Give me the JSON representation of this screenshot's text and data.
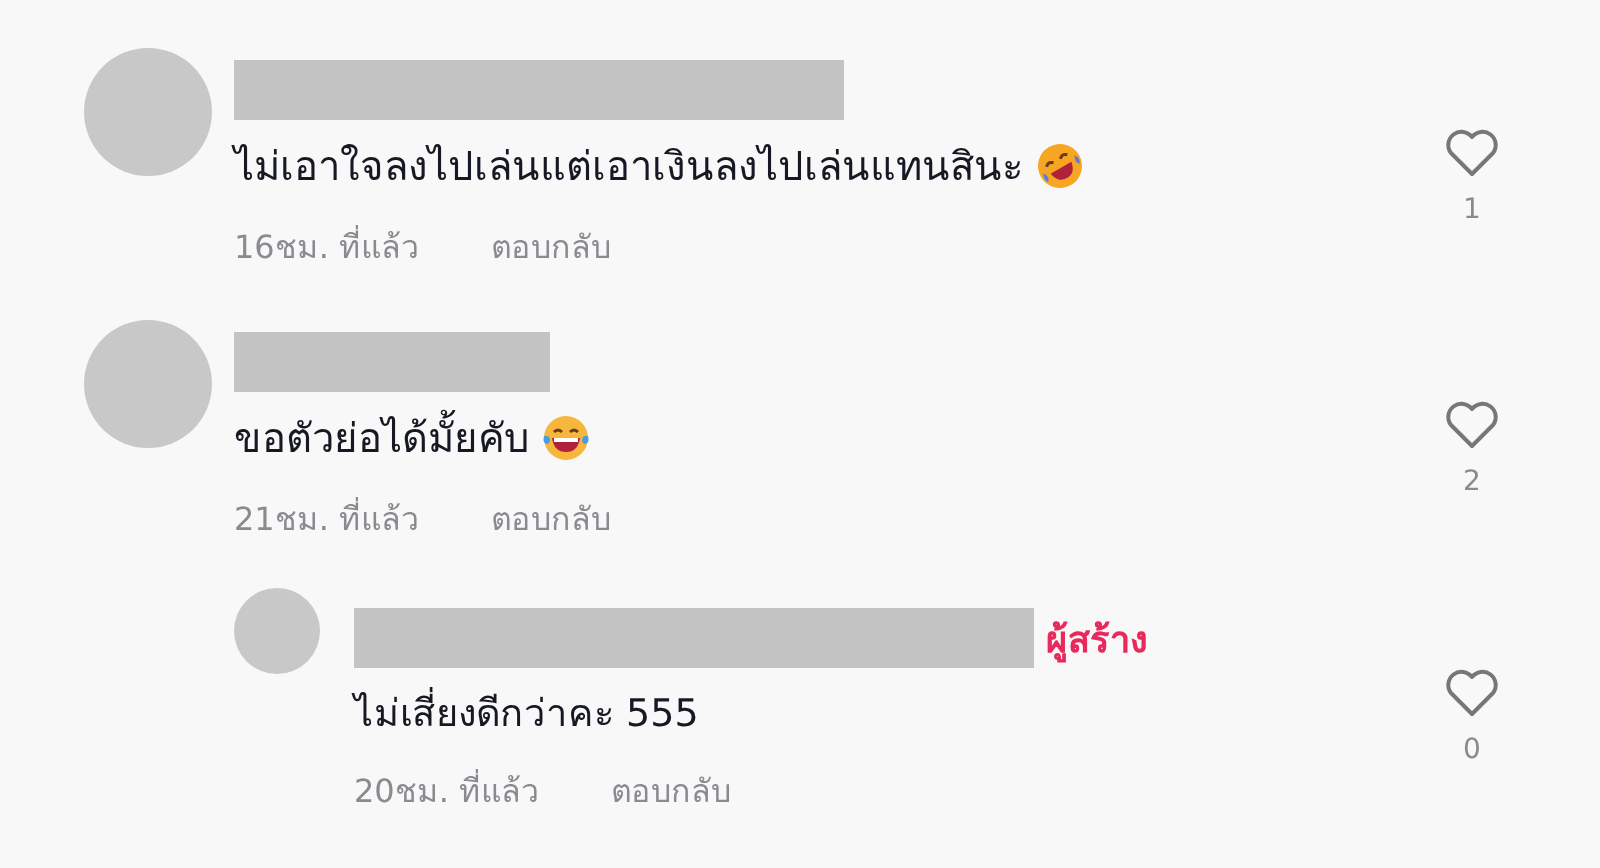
{
  "comments": [
    {
      "kind": "comment",
      "text": "ไม่เอาใจลงไปเล่นแต่เอาเงินลงไปเล่นแทนสินะ",
      "emoji": {
        "kind": "rofl"
      },
      "time": "16ชม. ที่แล้ว",
      "reply": "ตอบกลับ",
      "likes": "1"
    },
    {
      "kind": "comment",
      "text": "ขอตัวย่อได้มั้ยคับ",
      "emoji": {
        "kind": "joy"
      },
      "time": "21ชม. ที่แล้ว",
      "reply": "ตอบกลับ",
      "likes": "2"
    },
    {
      "kind": "reply",
      "creator_label": "ผู้สร้าง",
      "text": "ไม่เสี่ยงดีกว่าคะ 555",
      "time": "20ชม. ที่แล้ว",
      "reply": "ตอบกลับ",
      "likes": "0"
    }
  ]
}
